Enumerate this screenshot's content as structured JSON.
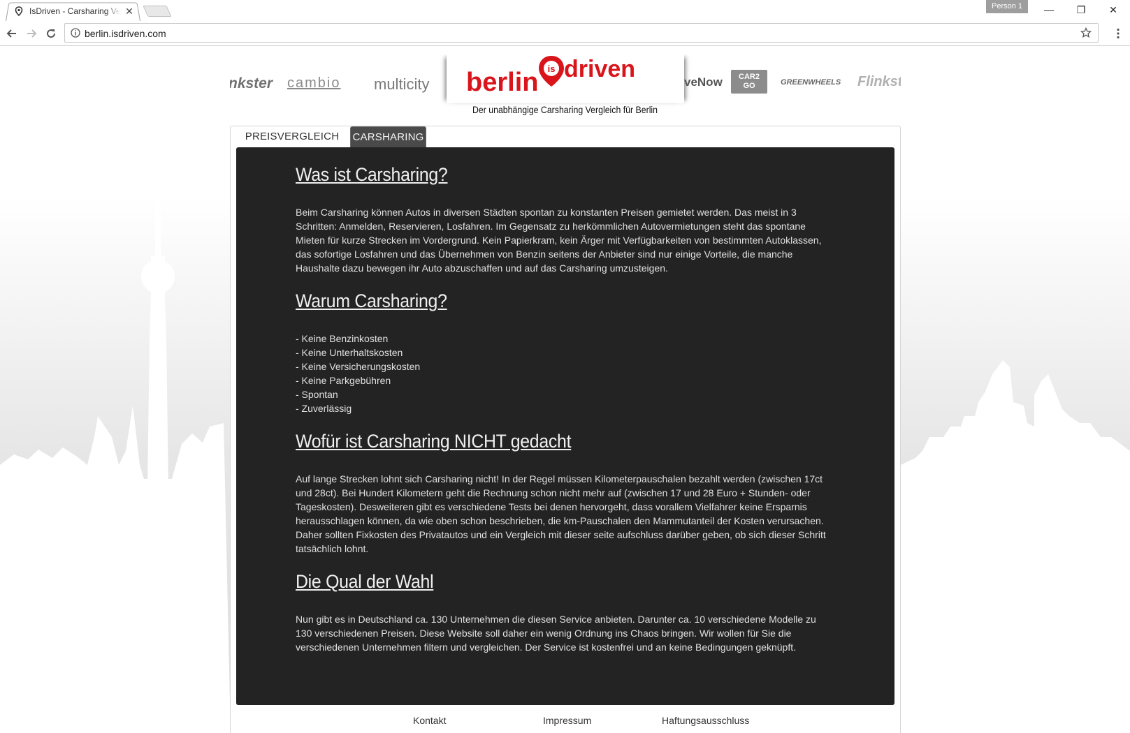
{
  "browser": {
    "tab_title": "IsDriven - Carsharing Vergleich",
    "tab_close": "✕",
    "profile": "Person 1",
    "url": "berlin.isdriven.com",
    "minimize": "—",
    "restore": "❐",
    "close": "✕"
  },
  "header": {
    "logo_left": "berlin",
    "logo_badge": "is",
    "logo_right": "driven",
    "tagline": "Der unabhängige Carsharing Vergleich für Berlin",
    "brands": {
      "drivenow": "veNow",
      "car2go": "CAR2GO",
      "greenwheels": "GREENWHEELS",
      "flinkster": "Flinkster",
      "nkster": "nkster",
      "cambio": "cambio",
      "multicity": "multicity"
    },
    "colors": {
      "brand_red": "#d9151b"
    }
  },
  "tabs": [
    {
      "label": "PREISVERGLEICH"
    },
    {
      "label": "CARSHARING"
    }
  ],
  "sections": [
    {
      "title": "Was ist Carsharing?",
      "text": "Beim Carsharing können Autos in diversen Städten spontan zu konstanten Preisen gemietet werden. Das meist in 3 Schritten: Anmelden, Reservieren, Losfahren. Im Gegensatz zu herkömmlichen Autovermietungen steht das spontane Mieten für kurze Strecken im Vordergrund. Kein Papierkram, kein Ärger mit Verfügbarkeiten von bestimmten Autoklassen, das sofortige Losfahren und das Übernehmen von Benzin seitens der Anbieter sind nur einige Vorteile, die manche Haushalte dazu bewegen ihr Auto abzuschaffen und auf das Carsharing umzusteigen."
    },
    {
      "title": "Warum Carsharing?",
      "items": [
        "- Keine Benzinkosten",
        "- Keine Unterhaltskosten",
        "- Keine Versicherungskosten",
        "- Keine Parkgebühren",
        "- Spontan",
        "- Zuverlässig"
      ]
    },
    {
      "title": "Wofür ist Carsharing NICHT gedacht",
      "text": "Auf lange Strecken lohnt sich Carsharing nicht! In der Regel müssen Kilometerpauschalen bezahlt werden (zwischen 17ct und 28ct). Bei Hundert Kilometern geht die Rechnung schon nicht mehr auf (zwischen 17 und 28 Euro + Stunden- oder Tageskosten). Desweiteren gibt es verschiedene Tests bei denen hervorgeht, dass vorallem Vielfahrer keine Ersparnis herausschlagen können, da wie oben schon beschrieben, die km-Pauschalen den Mammutanteil der Kosten verursachen. Daher sollten Fixkosten des Privatautos und ein Vergleich mit dieser seite aufschluss darüber geben, ob sich dieser Schritt tatsächlich lohnt."
    },
    {
      "title": "Die Qual der Wahl",
      "text": "Nun gibt es in Deutschland ca. 130 Unternehmen die diesen Service anbieten. Darunter ca. 10 verschiedene Modelle zu 130 verschiedenen Preisen. Diese Website soll daher ein wenig Ordnung ins Chaos bringen. Wir wollen für Sie die verschiedenen Unternehmen filtern und vergleichen. Der Service ist kostenfrei und an keine Bedingungen geknüpft."
    }
  ],
  "footer": {
    "kontakt": "Kontakt",
    "impressum": "Impressum",
    "haftung": "Haftungsausschluss"
  }
}
